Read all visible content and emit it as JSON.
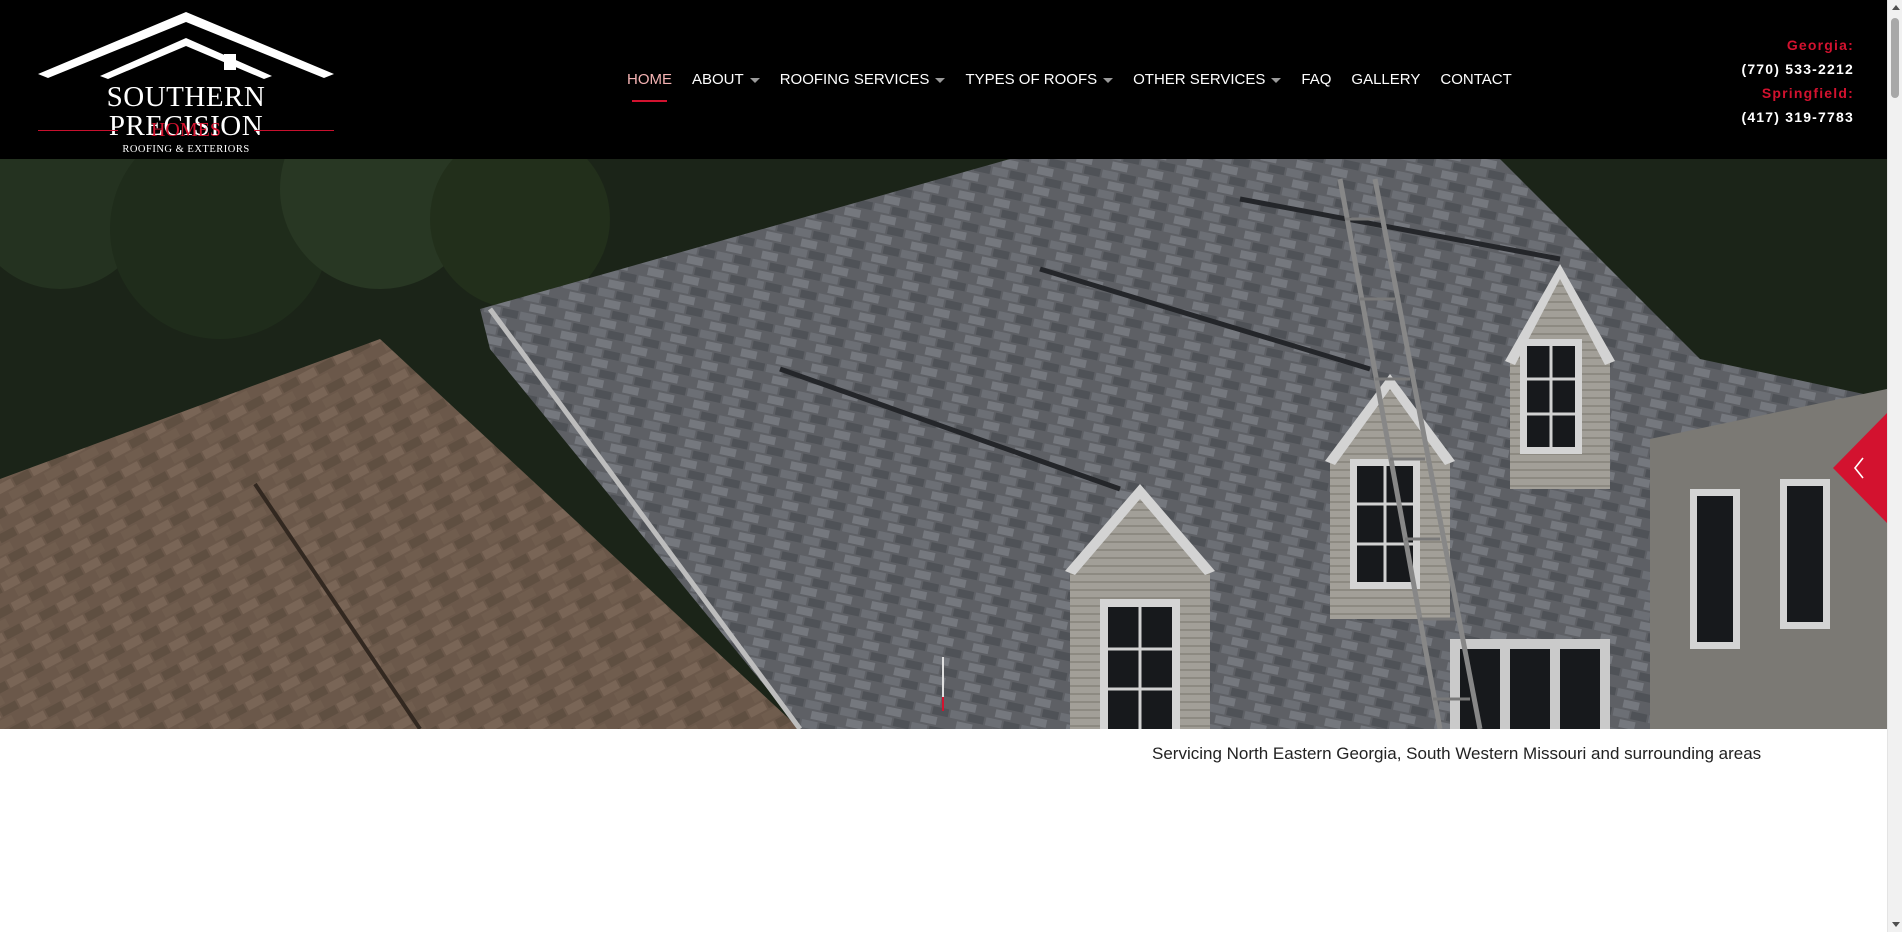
{
  "logo": {
    "title": "SOUTHERN PRECISION",
    "homes": "HOMES",
    "subtitle": "ROOFING & EXTERIORS"
  },
  "nav": {
    "items": [
      {
        "label": "HOME",
        "active": true,
        "dropdown": false
      },
      {
        "label": "ABOUT",
        "active": false,
        "dropdown": true
      },
      {
        "label": "ROOFING SERVICES",
        "active": false,
        "dropdown": true
      },
      {
        "label": "TYPES OF ROOFS",
        "active": false,
        "dropdown": true
      },
      {
        "label": "OTHER SERVICES",
        "active": false,
        "dropdown": true
      },
      {
        "label": "FAQ",
        "active": false,
        "dropdown": false
      },
      {
        "label": "GALLERY",
        "active": false,
        "dropdown": false
      },
      {
        "label": "CONTACT",
        "active": false,
        "dropdown": false
      }
    ]
  },
  "contacts": {
    "georgia_label": "Georgia:",
    "georgia_phone": "(770) 533-2212",
    "springfield_label": "Springfield:",
    "springfield_phone": "(417) 319-7783"
  },
  "hero": {
    "prev_icon": "chevron-left-icon"
  },
  "tagline": "Servicing North Eastern Georgia, South Western Missouri and surrounding areas",
  "colors": {
    "accent": "#d3122f",
    "header_bg": "#000000",
    "nav_active": "#f4b3b3"
  }
}
